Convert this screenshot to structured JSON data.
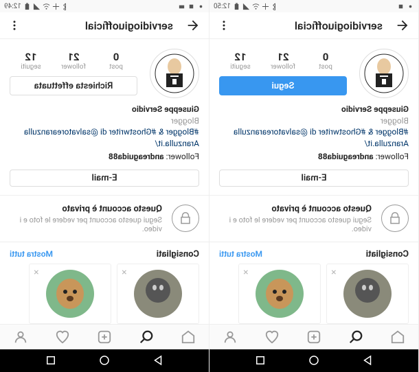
{
  "left": {
    "status": {
      "time": "12:50"
    },
    "header": {
      "username": "servidiogiuofficial"
    },
    "stats": {
      "post_num": "0",
      "post_label": "post",
      "follower_num": "21",
      "follower_label": "follower",
      "following_num": "12",
      "following_label": "seguiti"
    },
    "follow_button": {
      "label": "Segui",
      "style": "primary"
    },
    "bio": {
      "name": "Giuseppe Servidio",
      "role": "Blogger",
      "desc_prefix": "#Blogger & #Ghostwriter di ",
      "desc_handle": "@salvatorearanzulla",
      "link": "Aranzulla.it/",
      "follower_pre": "Follower: ",
      "follower_name": "andreaguida88"
    },
    "email": "E-mail",
    "private": {
      "title": "Questo account è privato",
      "sub": "Segui questo account per vedere le foto e i video."
    },
    "suggested": {
      "title": "Consigliati",
      "all": "Mostra tutti"
    }
  },
  "right": {
    "status": {
      "time": "12:49"
    },
    "header": {
      "username": "servidiogiuofficial"
    },
    "stats": {
      "post_num": "0",
      "post_label": "post",
      "follower_num": "21",
      "follower_label": "follower",
      "following_num": "12",
      "following_label": "seguiti"
    },
    "follow_button": {
      "label": "Richiesta effettuata",
      "style": "secondary"
    },
    "bio": {
      "name": "Giuseppe Servidio",
      "role": "Blogger",
      "desc_prefix": "#Blogger & #Ghostwriter di ",
      "desc_handle": "@salvatorearanzulla",
      "link": "Aranzulla.it/",
      "follower_pre": "Follower: ",
      "follower_name": "andreaguida88"
    },
    "email": "E-mail",
    "private": {
      "title": "Questo account è privato",
      "sub": "Segui questo account per vedere le foto e i video."
    },
    "suggested": {
      "title": "Consigliati",
      "all": "Mostra tutti"
    }
  }
}
